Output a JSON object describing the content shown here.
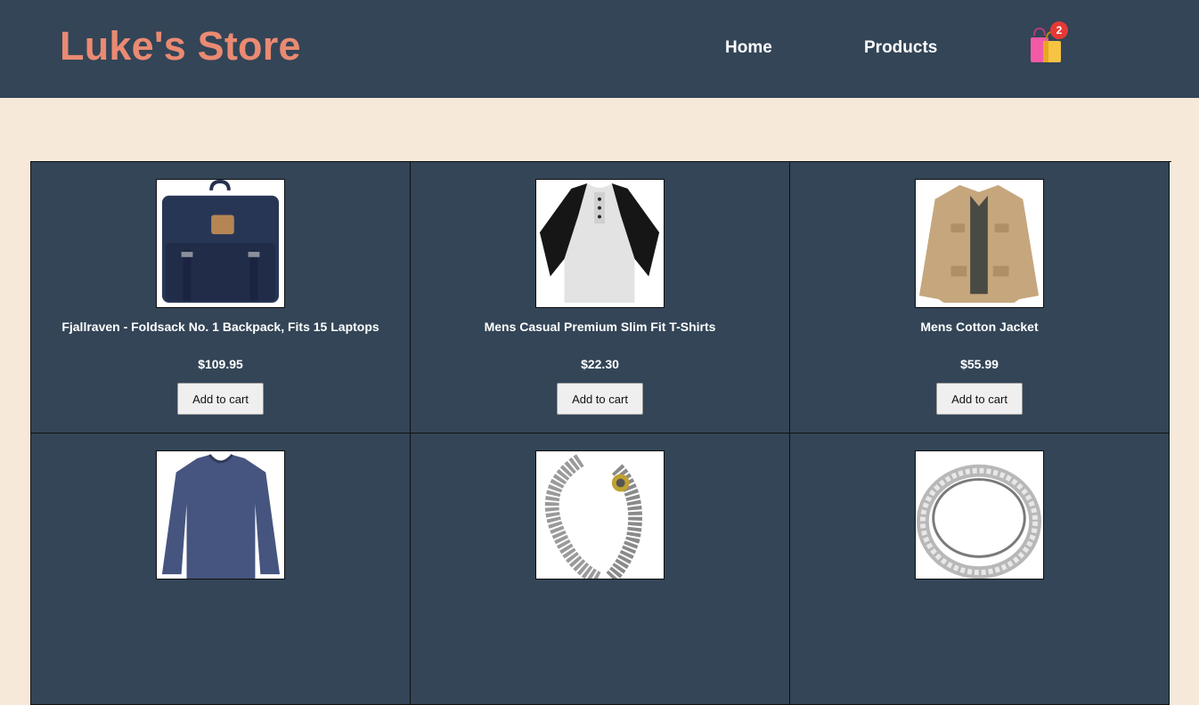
{
  "header": {
    "brand": "Luke's Store",
    "nav": [
      {
        "label": "Home"
      },
      {
        "label": "Products"
      }
    ],
    "cart": {
      "icon": "shopping-bags-icon",
      "count": "2"
    }
  },
  "products": [
    {
      "title": "Fjallraven - Foldsack No. 1 Backpack, Fits 15 Laptops",
      "price": "$109.95",
      "button": "Add to cart",
      "icon": "backpack-image"
    },
    {
      "title": "Mens Casual Premium Slim Fit T-Shirts",
      "price": "$22.30",
      "button": "Add to cart",
      "icon": "tshirt-image"
    },
    {
      "title": "Mens Cotton Jacket",
      "price": "$55.99",
      "button": "Add to cart",
      "icon": "jacket-image"
    },
    {
      "title": "",
      "price": "",
      "button": "",
      "icon": "longsleeve-image"
    },
    {
      "title": "",
      "price": "",
      "button": "",
      "icon": "bracelet-image"
    },
    {
      "title": "",
      "price": "",
      "button": "",
      "icon": "ring-image"
    }
  ],
  "colors": {
    "header_bg": "#334557",
    "page_bg": "#f7e9d9",
    "brand": "#ea8a72",
    "badge": "#e53935"
  }
}
